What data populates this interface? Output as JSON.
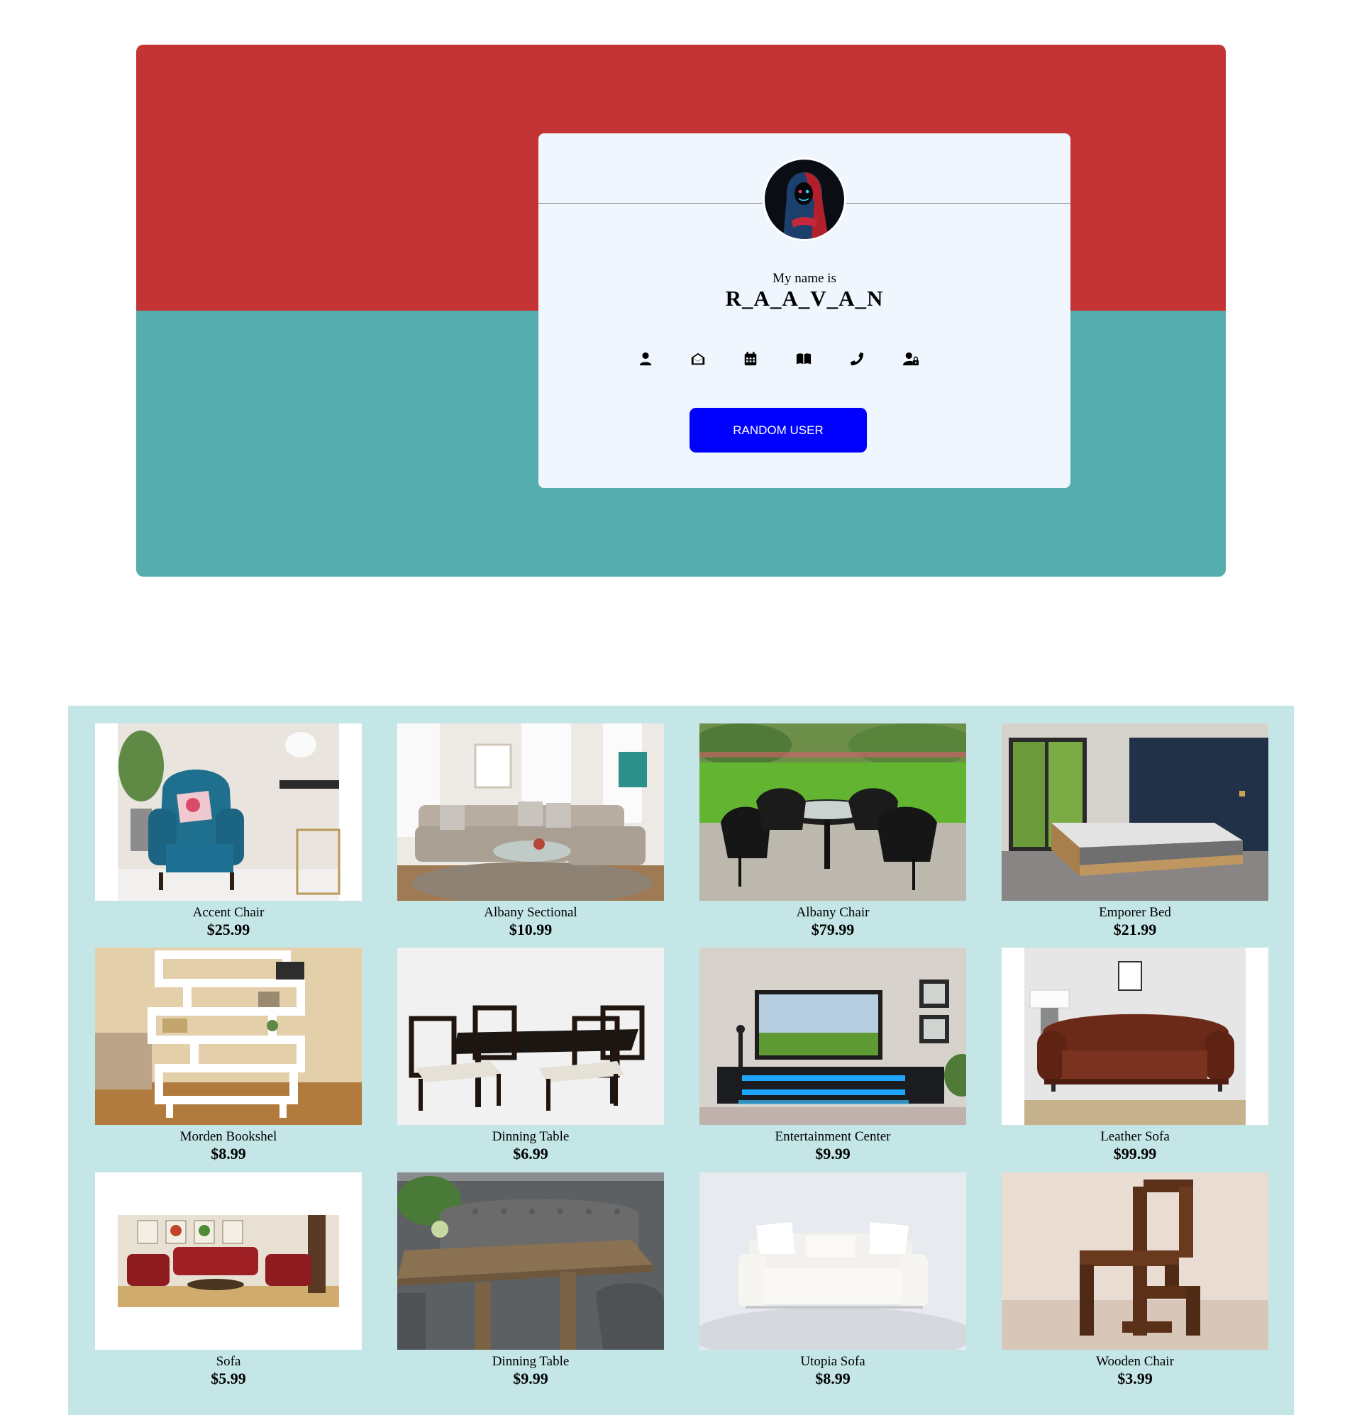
{
  "colors": {
    "hero_top": "#c53434",
    "hero_bottom": "#55adad",
    "card_bg": "#eff6fd",
    "button_bg": "#0000ff",
    "products_bg": "#c4e6e6"
  },
  "profile": {
    "name_label": "My name is",
    "name_value": "R_A_A_V_A_N",
    "avatar": "hooded-figure-avatar",
    "icons": [
      "user-icon",
      "envelope-open-icon",
      "calendar-icon",
      "book-open-icon",
      "phone-icon",
      "user-lock-icon"
    ],
    "button_label": "RANDOM USER"
  },
  "products": [
    {
      "name": "Accent Chair",
      "price": "$25.99"
    },
    {
      "name": "Albany Sectional",
      "price": "$10.99"
    },
    {
      "name": "Albany Chair",
      "price": "$79.99"
    },
    {
      "name": "Emporer Bed",
      "price": "$21.99"
    },
    {
      "name": "Morden Bookshel",
      "price": "$8.99"
    },
    {
      "name": "Dinning Table",
      "price": "$6.99"
    },
    {
      "name": "Entertainment Center",
      "price": "$9.99"
    },
    {
      "name": "Leather Sofa",
      "price": "$99.99"
    },
    {
      "name": "Sofa",
      "price": "$5.99"
    },
    {
      "name": "Dinning Table",
      "price": "$9.99"
    },
    {
      "name": "Utopia Sofa",
      "price": "$8.99"
    },
    {
      "name": "Wooden Chair",
      "price": "$3.99"
    }
  ]
}
